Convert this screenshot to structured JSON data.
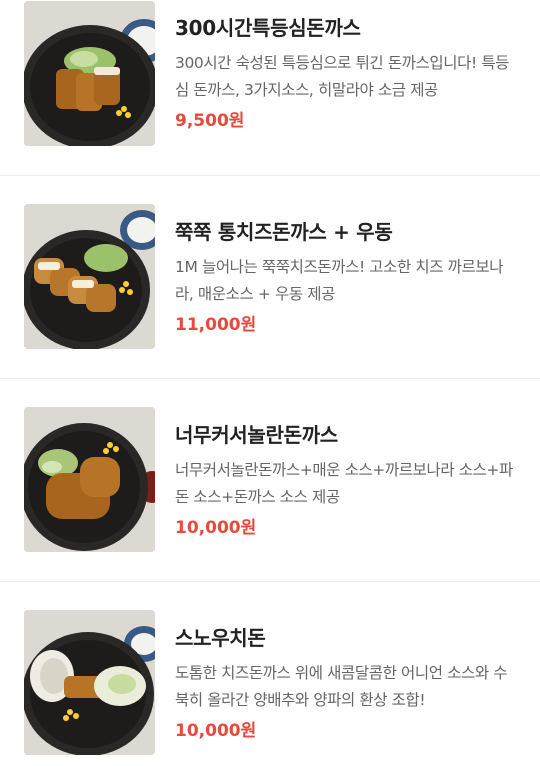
{
  "menu": {
    "items": [
      {
        "name": "300시간특등심돈까스",
        "description": "300시간 숙성된 특등심으로 튀긴 돈까스입니다! 특등심 돈까스, 3가지소스, 히말라야 소금 제공",
        "price": "9,500원",
        "image_icon": "pork-cutlet-plate-image"
      },
      {
        "name": "쭉쭉 통치즈돈까스 + 우동",
        "description": "1M 늘어나는 쭉쭉치즈돈까스! 고소한 치즈 까르보나라, 매운소스 + 우동 제공",
        "price": "11,000원",
        "image_icon": "cheese-cutlet-plate-image"
      },
      {
        "name": "너무커서놀란돈까스",
        "description": "너무커서놀란돈까스+매운 소스+까르보나라 소스+파돈 소스+돈까스 소스 제공",
        "price": "10,000원",
        "image_icon": "big-cutlet-plate-image"
      },
      {
        "name": "스노우치돈",
        "description": "도톰한 치즈돈까스 위에 새콤달콤한 어니언 소스와 수북히 올라간 양배추와 양파의 환상 조합!",
        "price": "10,000원",
        "image_icon": "snow-cutlet-plate-image"
      }
    ]
  },
  "colors": {
    "price": "#e64a3c",
    "title": "#222222",
    "description": "#666666",
    "divider": "#ececec"
  }
}
